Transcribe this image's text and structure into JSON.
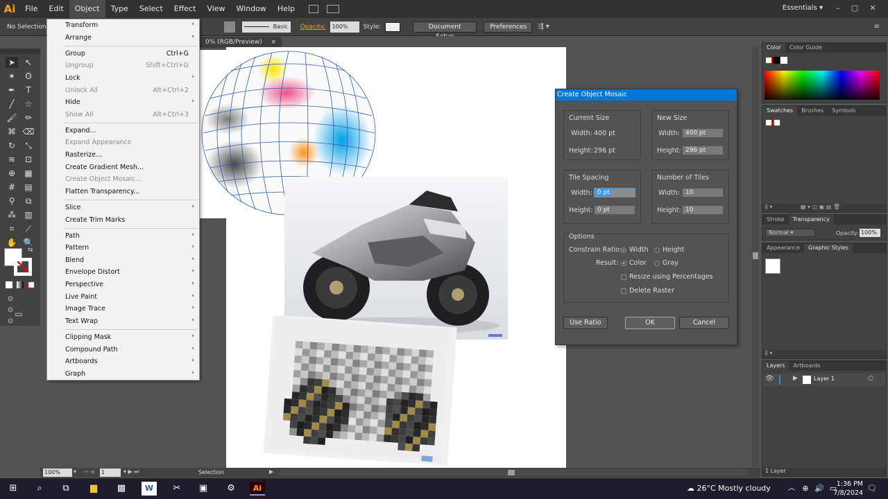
{
  "app": {
    "logo": "Ai",
    "menu": [
      "File",
      "Edit",
      "Object",
      "Type",
      "Select",
      "Effect",
      "View",
      "Window",
      "Help"
    ],
    "workspace": "Essentials"
  },
  "controlbar": {
    "selection": "No Selection",
    "stroke_style": "Basic",
    "opacity_label": "Opacity:",
    "opacity_value": "100%",
    "style_label": "Style:",
    "document_setup": "Document Setup",
    "preferences": "Preferences"
  },
  "document": {
    "tab_title": "0% (RGB/Preview)",
    "close": "×"
  },
  "object_menu": {
    "items": [
      {
        "label": "Transform",
        "shortcut": "",
        "submenu": true,
        "disabled": false
      },
      {
        "label": "Arrange",
        "shortcut": "",
        "submenu": true,
        "disabled": false
      },
      {
        "label": "Group",
        "shortcut": "Ctrl+G",
        "submenu": false,
        "disabled": false
      },
      {
        "label": "Ungroup",
        "shortcut": "Shift+Ctrl+G",
        "submenu": false,
        "disabled": true
      },
      {
        "label": "Lock",
        "shortcut": "",
        "submenu": true,
        "disabled": false
      },
      {
        "label": "Unlock All",
        "shortcut": "Alt+Ctrl+2",
        "submenu": false,
        "disabled": true
      },
      {
        "label": "Hide",
        "shortcut": "",
        "submenu": true,
        "disabled": false
      },
      {
        "label": "Show All",
        "shortcut": "Alt+Ctrl+3",
        "submenu": false,
        "disabled": true
      },
      {
        "label": "Expand...",
        "shortcut": "",
        "submenu": false,
        "disabled": false
      },
      {
        "label": "Expand Appearance",
        "shortcut": "",
        "submenu": false,
        "disabled": true
      },
      {
        "label": "Rasterize...",
        "shortcut": "",
        "submenu": false,
        "disabled": false
      },
      {
        "label": "Create Gradient Mesh...",
        "shortcut": "",
        "submenu": false,
        "disabled": false
      },
      {
        "label": "Create Object Mosaic...",
        "shortcut": "",
        "submenu": false,
        "disabled": true
      },
      {
        "label": "Flatten Transparency...",
        "shortcut": "",
        "submenu": false,
        "disabled": false
      },
      {
        "label": "Slice",
        "shortcut": "",
        "submenu": true,
        "disabled": false
      },
      {
        "label": "Create Trim Marks",
        "shortcut": "",
        "submenu": false,
        "disabled": false
      },
      {
        "label": "Path",
        "shortcut": "",
        "submenu": true,
        "disabled": false
      },
      {
        "label": "Pattern",
        "shortcut": "",
        "submenu": true,
        "disabled": false
      },
      {
        "label": "Blend",
        "shortcut": "",
        "submenu": true,
        "disabled": false
      },
      {
        "label": "Envelope Distort",
        "shortcut": "",
        "submenu": true,
        "disabled": false
      },
      {
        "label": "Perspective",
        "shortcut": "",
        "submenu": true,
        "disabled": false
      },
      {
        "label": "Live Paint",
        "shortcut": "",
        "submenu": true,
        "disabled": false
      },
      {
        "label": "Image Trace",
        "shortcut": "",
        "submenu": true,
        "disabled": false
      },
      {
        "label": "Text Wrap",
        "shortcut": "",
        "submenu": true,
        "disabled": false
      },
      {
        "label": "Clipping Mask",
        "shortcut": "",
        "submenu": true,
        "disabled": false
      },
      {
        "label": "Compound Path",
        "shortcut": "",
        "submenu": true,
        "disabled": false
      },
      {
        "label": "Artboards",
        "shortcut": "",
        "submenu": true,
        "disabled": false
      },
      {
        "label": "Graph",
        "shortcut": "",
        "submenu": true,
        "disabled": false
      }
    ]
  },
  "dialog": {
    "title": "Create Object Mosaic",
    "current_size": {
      "title": "Current Size",
      "width_label": "Width:",
      "width": "400 pt",
      "height_label": "Height:",
      "height": "296 pt"
    },
    "new_size": {
      "title": "New Size",
      "width_label": "Width:",
      "width": "400 pt",
      "height_label": "Height:",
      "height": "296 pt"
    },
    "tile_spacing": {
      "title": "Tile Spacing",
      "width_label": "Width:",
      "width": "0 pt",
      "height_label": "Height:",
      "height": "0 pt"
    },
    "num_tiles": {
      "title": "Number of Tiles",
      "width_label": "Width:",
      "width": "10",
      "height_label": "Height:",
      "height": "10"
    },
    "options": {
      "title": "Options",
      "constrain_label": "Constrain Ratio:",
      "constrain_width": "Width",
      "constrain_height": "Height",
      "result_label": "Result:",
      "result_color": "Color",
      "result_gray": "Gray",
      "resize_pct": "Resize using Percentages",
      "delete_raster": "Delete Raster"
    },
    "buttons": {
      "use_ratio": "Use Ratio",
      "ok": "OK",
      "cancel": "Cancel"
    }
  },
  "panels": {
    "color_tabs": [
      "Color",
      "Color Guide"
    ],
    "swatch_tabs": [
      "Swatches",
      "Brushes",
      "Symbols"
    ],
    "transparency_tabs": [
      "Stroke",
      "Transparency"
    ],
    "blend_mode": "Normal",
    "opacity_label": "Opacity:",
    "opacity_value": "100%",
    "styles_tabs": [
      "Appearance",
      "Graphic Styles"
    ],
    "layers_tabs": [
      "Layers",
      "Artboards"
    ],
    "layer_name": "Layer 1",
    "layers_count": "1 Layer"
  },
  "status": {
    "zoom": "100%",
    "artboard": "1",
    "tool": "Selection"
  },
  "taskbar": {
    "weather": "26°C  Mostly cloudy",
    "time": "1:36 PM",
    "date": "7/8/2024"
  },
  "colors": {
    "accent": "#0078d7",
    "ai_orange": "#f7a21b",
    "panel_dark": "#424242"
  }
}
